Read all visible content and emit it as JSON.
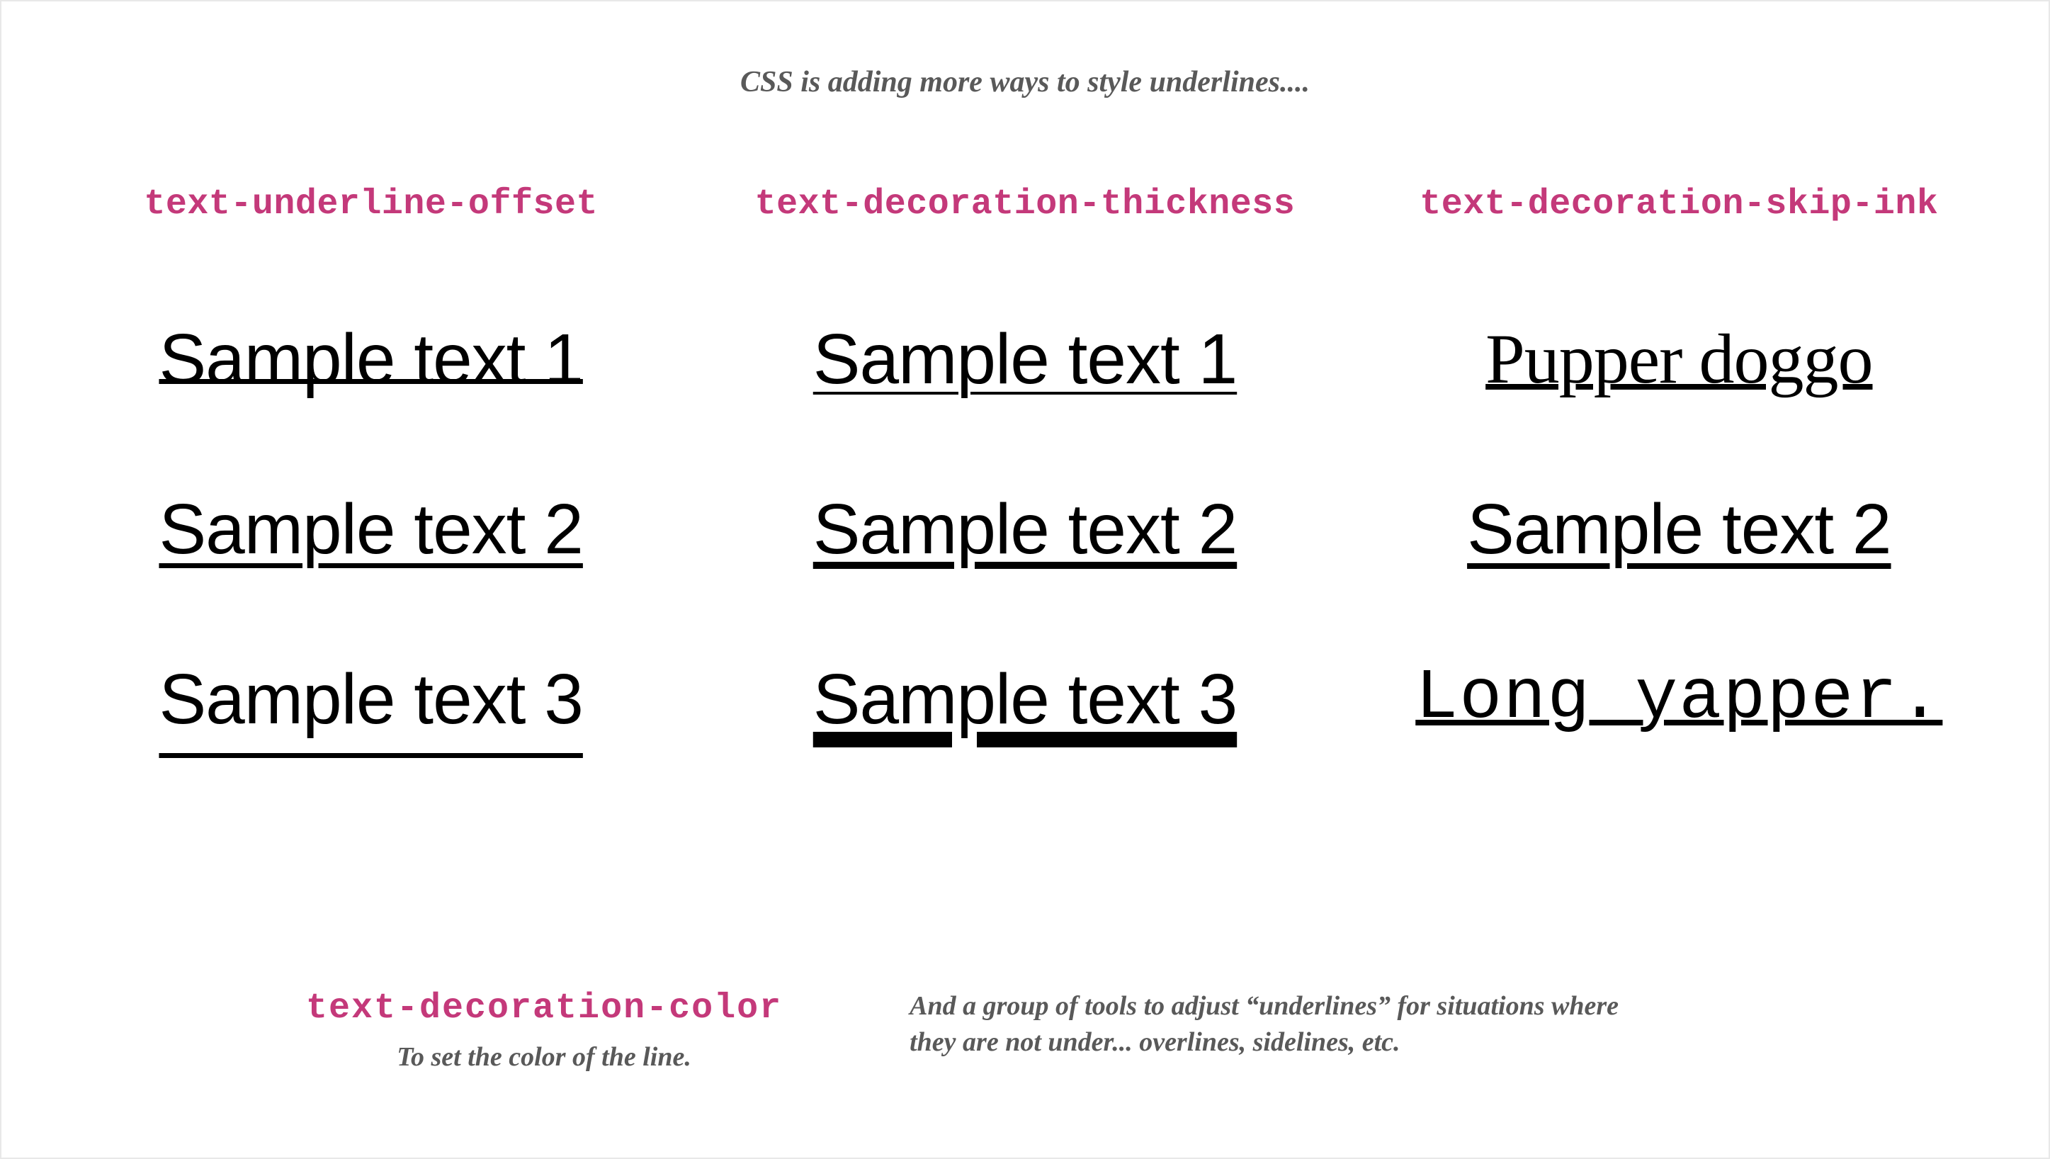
{
  "intro": "CSS is adding more ways to style underlines....",
  "columns": [
    {
      "heading": "text-underline-offset",
      "samples": [
        "Sample text 1",
        "Sample text 2",
        "Sample text 3"
      ]
    },
    {
      "heading": "text-decoration-thickness",
      "samples": [
        "Sample text 1",
        "Sample text 2",
        "Sample text 3"
      ]
    },
    {
      "heading": "text-decoration-skip-ink",
      "samples": [
        "Pupper doggo",
        "Sample text 2",
        "Long yapper."
      ]
    }
  ],
  "footer": {
    "prop": "text-decoration-color",
    "sub": "To set the color of the line.",
    "note": "And a group of tools to adjust “underlines” for situations where they are not under... overlines, sidelines, etc."
  }
}
